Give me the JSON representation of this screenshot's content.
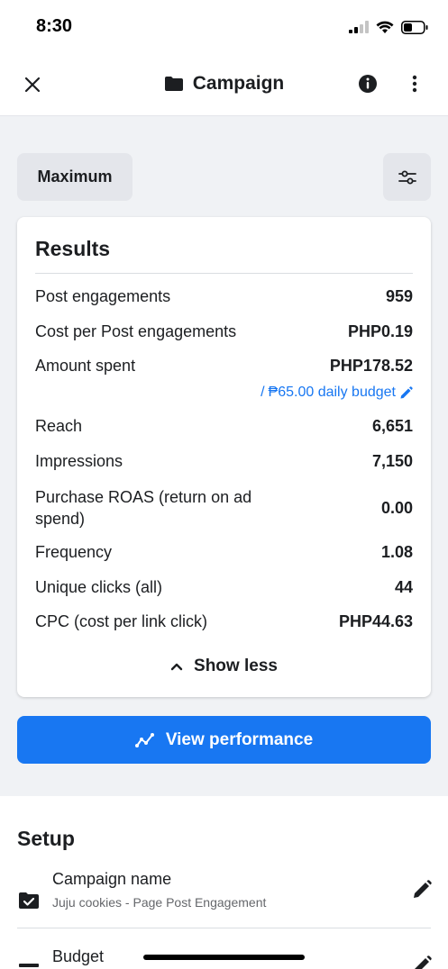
{
  "status_bar": {
    "time": "8:30"
  },
  "header": {
    "title": "Campaign"
  },
  "controls": {
    "date_range_label": "Maximum"
  },
  "results": {
    "title": "Results",
    "metrics": [
      {
        "label": "Post engagements",
        "value": "959"
      },
      {
        "label": "Cost per Post engagements",
        "value": "PHP0.19"
      },
      {
        "label": "Amount spent",
        "value": "PHP178.52"
      },
      {
        "label": "Reach",
        "value": "6,651"
      },
      {
        "label": "Impressions",
        "value": "7,150"
      },
      {
        "label": "Purchase ROAS (return on ad spend)",
        "value": "0.00"
      },
      {
        "label": "Frequency",
        "value": "1.08"
      },
      {
        "label": "Unique clicks (all)",
        "value": "44"
      },
      {
        "label": "CPC (cost per link click)",
        "value": "PHP44.63"
      }
    ],
    "daily_budget_prefix": "/",
    "daily_budget_link": "₱65.00 daily budget",
    "show_less_label": "Show less"
  },
  "view_performance_label": "View performance",
  "setup": {
    "title": "Setup",
    "items": [
      {
        "label": "Campaign name",
        "sub": "Juju cookies - Page Post Engagement",
        "icon": "folder-check-icon"
      },
      {
        "label": "Budget",
        "sub": "",
        "icon": "budget-icon"
      }
    ]
  },
  "colors": {
    "accent": "#1877f2",
    "background_gray": "#f0f2f5",
    "button_gray": "#e4e6eb"
  }
}
